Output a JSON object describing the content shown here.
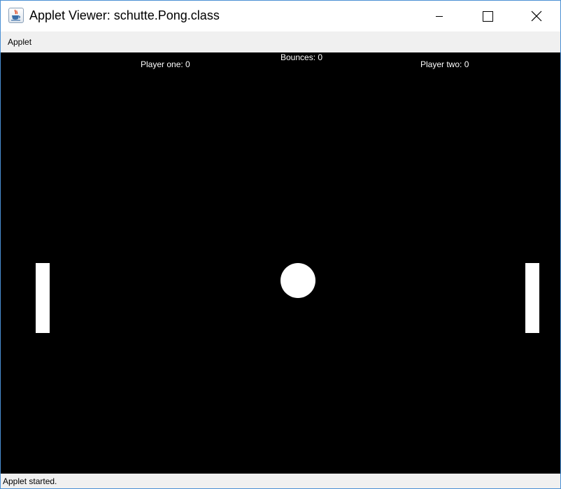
{
  "window": {
    "title": "Applet Viewer: schutte.Pong.class",
    "icon": "java-coffee-cup-icon"
  },
  "controls": {
    "minimize_icon": "minimize-icon",
    "maximize_icon": "maximize-icon",
    "close_icon": "close-icon"
  },
  "menubar": {
    "items": [
      {
        "label": "Applet"
      }
    ]
  },
  "game": {
    "bounces": "Bounces: 0",
    "player_one": "Player one: 0",
    "player_two": "Player two: 0",
    "background_color": "#000000",
    "foreground_color": "#ffffff"
  },
  "status": {
    "text": "Applet started."
  }
}
